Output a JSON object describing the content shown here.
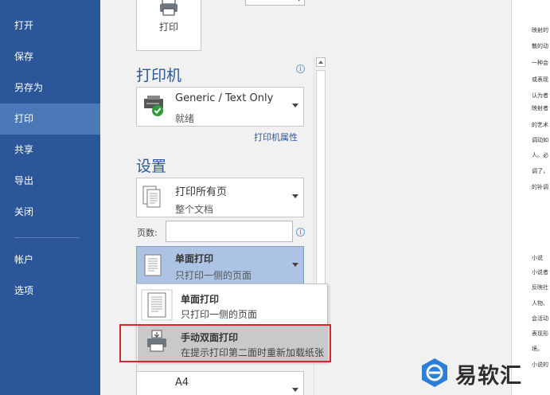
{
  "sidebar": {
    "items": [
      {
        "label": "打开"
      },
      {
        "label": "保存"
      },
      {
        "label": "另存为"
      },
      {
        "label": "打印"
      },
      {
        "label": "共享"
      },
      {
        "label": "导出"
      },
      {
        "label": "关闭"
      },
      {
        "label": "帐户"
      },
      {
        "label": "选项"
      }
    ],
    "active_color": "#4a78b9",
    "bg_color": "#2b579a"
  },
  "print_button": {
    "label": "打印",
    "icon": "printer-icon"
  },
  "printer": {
    "title": "打印机",
    "name": "Generic / Text Only",
    "status": "就绪",
    "properties_link": "打印机属性"
  },
  "settings": {
    "title": "设置",
    "range": {
      "main": "打印所有页",
      "sub": "整个文档"
    },
    "pages_label": "页数:",
    "pages_value": "",
    "sides": {
      "main": "单面打印",
      "sub": "只打印一侧的页面"
    },
    "paper": {
      "main": "A4"
    }
  },
  "sides_menu": {
    "options": [
      {
        "main": "单面打印",
        "sub": "只打印一侧的页面"
      },
      {
        "main": "手动双面打印",
        "sub": "在提示打印第二面时重新加载纸张"
      }
    ]
  },
  "preview": {
    "lines": [
      "映射的",
      "散的动",
      "一种会",
      "或表现",
      "认为者",
      "映射者",
      "的艺术",
      "调动如",
      "人。必",
      "调了，",
      "的补调",
      "小说",
      "小说者",
      "反映社",
      "人物、",
      "会活动",
      "表现形",
      "境。",
      "小说的"
    ]
  },
  "watermark": {
    "text": "易软汇"
  },
  "colors": {
    "accent": "#2b579a",
    "highlight_border": "#d9262c",
    "selected_bg": "#adc3e3"
  }
}
